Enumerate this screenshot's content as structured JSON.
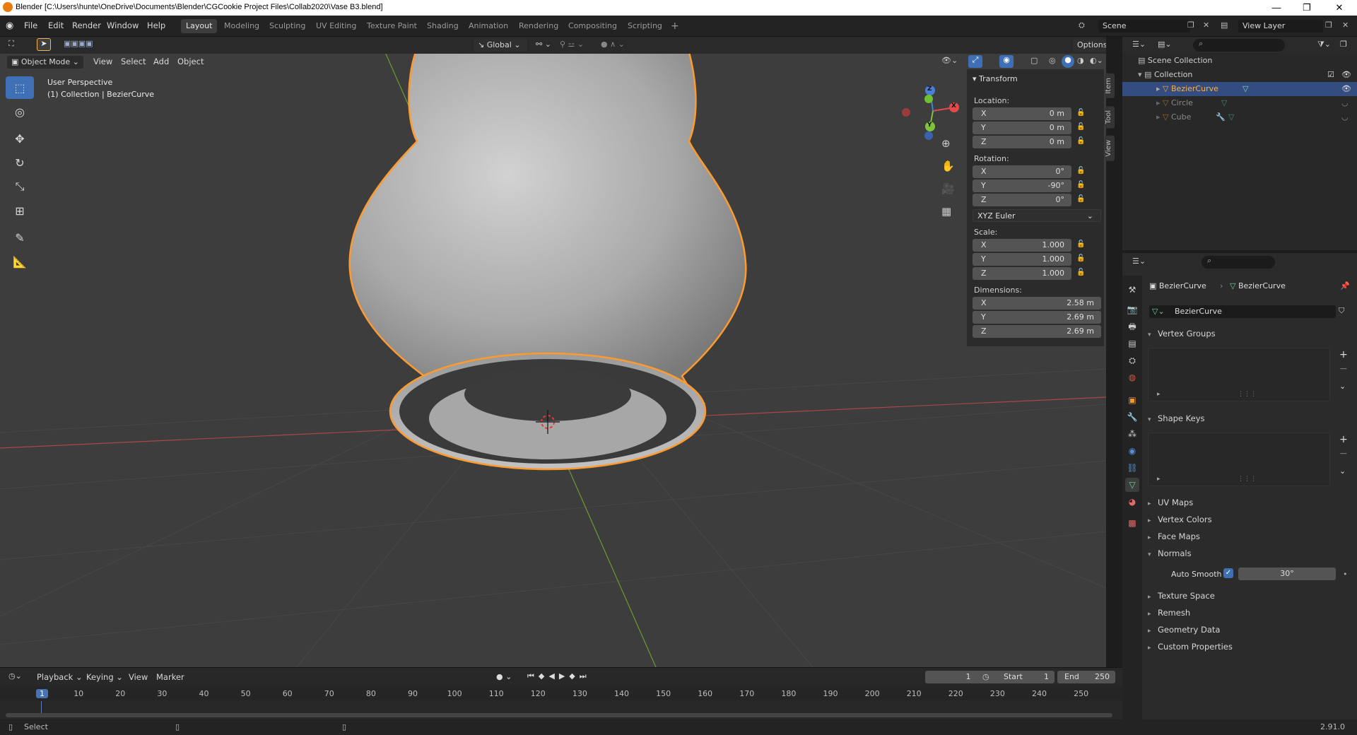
{
  "window": {
    "title": "Blender [C:\\Users\\hunte\\OneDrive\\Documents\\Blender\\CGCookie Project Files\\Collab2020\\Vase B3.blend]",
    "minimize": "—",
    "maximize": "❐",
    "close": "✕"
  },
  "menus": [
    "File",
    "Edit",
    "Render",
    "Window",
    "Help"
  ],
  "workspaces": [
    {
      "label": "Layout",
      "active": true
    },
    {
      "label": "Modeling"
    },
    {
      "label": "Sculpting"
    },
    {
      "label": "UV Editing"
    },
    {
      "label": "Texture Paint"
    },
    {
      "label": "Shading"
    },
    {
      "label": "Animation"
    },
    {
      "label": "Rendering"
    },
    {
      "label": "Compositing"
    },
    {
      "label": "Scripting"
    }
  ],
  "add_workspace": "+",
  "scene": {
    "label": "Scene",
    "view_layer": "View Layer"
  },
  "header3d": {
    "mode": "Object Mode",
    "menus": [
      "View",
      "Select",
      "Add",
      "Object"
    ],
    "orientation": "Global",
    "options": "Options"
  },
  "viewport": {
    "perspective": "User Perspective",
    "collection": "(1) Collection | BezierCurve"
  },
  "gizmo": {
    "x": "X",
    "y": "Y",
    "z": "Z"
  },
  "npanel": {
    "section": "Transform",
    "location_label": "Location:",
    "location": [
      {
        "axis": "X",
        "value": "0 m"
      },
      {
        "axis": "Y",
        "value": "0 m"
      },
      {
        "axis": "Z",
        "value": "0 m"
      }
    ],
    "rotation_label": "Rotation:",
    "rotation": [
      {
        "axis": "X",
        "value": "0°"
      },
      {
        "axis": "Y",
        "value": "-90°"
      },
      {
        "axis": "Z",
        "value": "0°"
      }
    ],
    "rotation_mode": "XYZ Euler",
    "scale_label": "Scale:",
    "scale": [
      {
        "axis": "X",
        "value": "1.000"
      },
      {
        "axis": "Y",
        "value": "1.000"
      },
      {
        "axis": "Z",
        "value": "1.000"
      }
    ],
    "dimensions_label": "Dimensions:",
    "dimensions": [
      {
        "axis": "X",
        "value": "2.58 m"
      },
      {
        "axis": "Y",
        "value": "2.69 m"
      },
      {
        "axis": "Z",
        "value": "2.69 m"
      }
    ],
    "tabs": [
      "Item",
      "Tool",
      "View"
    ]
  },
  "outliner": {
    "scene_collection": "Scene Collection",
    "collection": "Collection",
    "items": [
      {
        "label": "BezierCurve",
        "selected": true
      },
      {
        "label": "Circle"
      },
      {
        "label": "Cube"
      }
    ]
  },
  "properties": {
    "object_name": "BezierCurve",
    "data_name": "BezierCurve",
    "mesh_name": "BezierCurve",
    "sections": {
      "vertex_groups": "Vertex Groups",
      "shape_keys": "Shape Keys",
      "uv_maps": "UV Maps",
      "vertex_colors": "Vertex Colors",
      "face_maps": "Face Maps",
      "normals": "Normals",
      "texture_space": "Texture Space",
      "remesh": "Remesh",
      "geometry_data": "Geometry Data",
      "custom_properties": "Custom Properties"
    },
    "auto_smooth_label": "Auto Smooth",
    "auto_smooth_angle": "30°"
  },
  "timeline": {
    "menus": [
      "Playback",
      "Keying",
      "View",
      "Marker"
    ],
    "current_frame": "1",
    "start_label": "Start",
    "start": "1",
    "end_label": "End",
    "end": "250",
    "ticks": [
      "1",
      "10",
      "20",
      "30",
      "40",
      "50",
      "60",
      "70",
      "80",
      "90",
      "100",
      "110",
      "120",
      "130",
      "140",
      "150",
      "160",
      "170",
      "180",
      "190",
      "200",
      "210",
      "220",
      "230",
      "240",
      "250"
    ]
  },
  "status": {
    "select": "Select",
    "version": "2.91.0"
  },
  "colors": {
    "accent": "#3f6fb5",
    "selection": "#ff9a2e",
    "bg_viewport": "#3d3d3d"
  }
}
